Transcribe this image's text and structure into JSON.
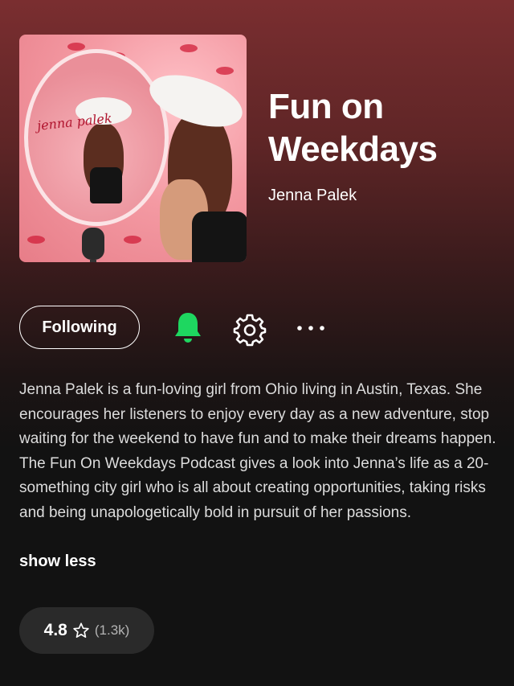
{
  "podcast": {
    "title": "Fun on Weekdays",
    "author": "Jenna Palek",
    "cover_text": "jenna palek"
  },
  "actions": {
    "following_label": "Following",
    "icons": [
      "bell-icon",
      "gear-icon",
      "more-options-icon"
    ],
    "accent_color": "#1ed760"
  },
  "description": {
    "text": "Jenna Palek is a fun-loving girl from Ohio living in Austin, Texas. She encourages her listeners to enjoy every day as a new adventure, stop waiting for the weekend to have fun and to make their dreams happen. The Fun On Weekdays Podcast gives a look into Jenna’s life as a 20-something city girl who is all about creating opportunities, taking risks and being unapologetically bold in pursuit of her passions.",
    "toggle_label": "show less"
  },
  "rating": {
    "value": "4.8",
    "count": "(1.3k)"
  }
}
